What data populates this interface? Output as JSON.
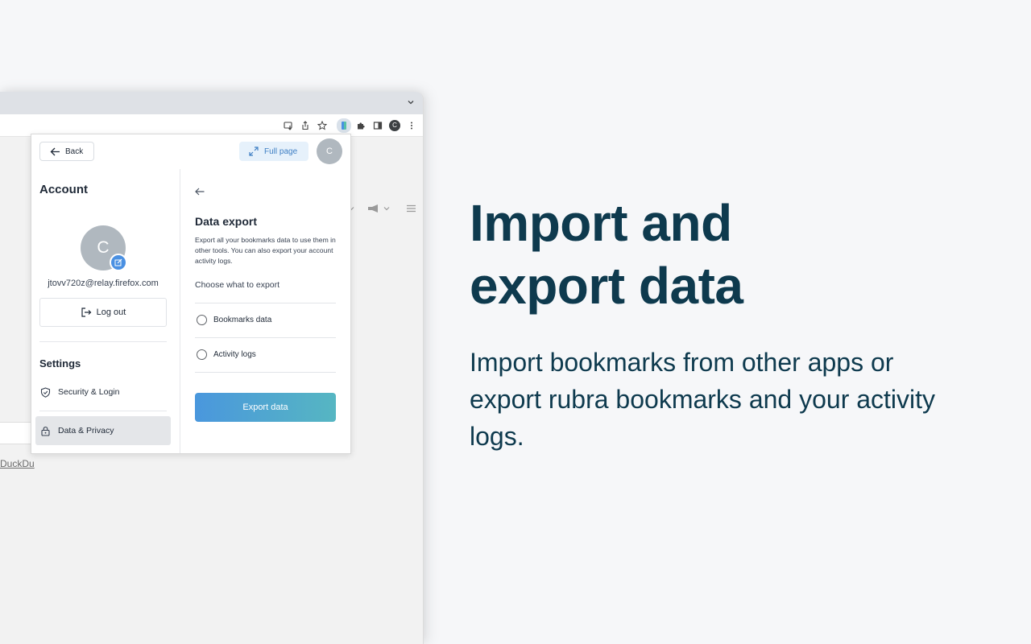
{
  "marketing": {
    "headline_line1": "Import and",
    "headline_line2": "export data",
    "subtext": "Import bookmarks from other apps or export rubra bookmarks and your activity logs."
  },
  "browser": {
    "toolbar_icons": [
      "install-icon",
      "share-icon",
      "star-icon",
      "rubra-extension-icon",
      "puzzle-icon",
      "sidepanel-icon",
      "profile-icon",
      "kebab-menu-icon"
    ],
    "profile_initial": "C",
    "background_link_text": "DuckDu"
  },
  "popup": {
    "back_label": "Back",
    "full_page_label": "Full page",
    "avatar_initial": "C",
    "account_title": "Account",
    "email": "jtovv720z@relay.firefox.com",
    "logout_label": "Log out",
    "settings_title": "Settings",
    "menu": {
      "security": "Security & Login",
      "data_privacy": "Data & Privacy"
    },
    "export": {
      "title": "Data export",
      "description": "Export all your bookmarks data to use them in other tools. You can also export your account activity logs.",
      "choose_label": "Choose what to export",
      "options": [
        "Bookmarks data",
        "Activity logs"
      ],
      "button_label": "Export data"
    }
  },
  "colors": {
    "headline": "#0e3a4e",
    "accent_blue": "#4a90e2",
    "export_gradient_start": "#4a97dd",
    "export_gradient_end": "#56b6c2"
  }
}
